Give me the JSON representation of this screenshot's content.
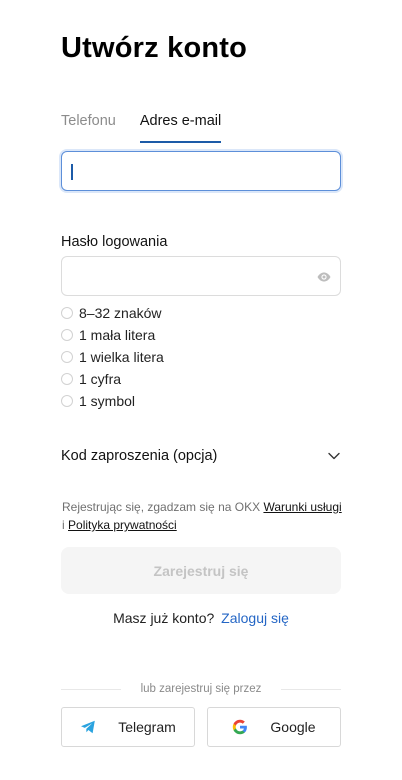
{
  "page": {
    "title": "Utwórz konto"
  },
  "tabs": [
    {
      "label": "Telefonu",
      "active": false
    },
    {
      "label": "Adres e-mail",
      "active": true
    }
  ],
  "email": {
    "value": "",
    "placeholder": ""
  },
  "password": {
    "label": "Hasło logowania",
    "value": "",
    "placeholder": "",
    "rules": [
      "8–32 znaków",
      "1 mała litera",
      "1 wielka litera",
      "1 cyfra",
      "1 symbol"
    ]
  },
  "invite": {
    "label": "Kod zaproszenia (opcja)",
    "icon": "chevron-down-icon"
  },
  "terms": {
    "prefix": "Rejestrując się, zgadzam się na OKX",
    "link_terms": "Warunki usługi",
    "separator": "i",
    "link_privacy": "Polityka prywatności"
  },
  "register": {
    "label": "Zarejestruj się",
    "disabled": true
  },
  "login": {
    "prompt": "Masz już konto?",
    "link": "Zaloguj się"
  },
  "social": {
    "divider": "lub zarejestruj się przez",
    "telegram": "Telegram",
    "google": "Google"
  },
  "colors": {
    "accent": "#1c5ba8",
    "link": "#2466c5",
    "telegram": "#2aa3df",
    "disabled_bg": "#f5f5f5",
    "disabled_text": "#c4c4c4"
  }
}
